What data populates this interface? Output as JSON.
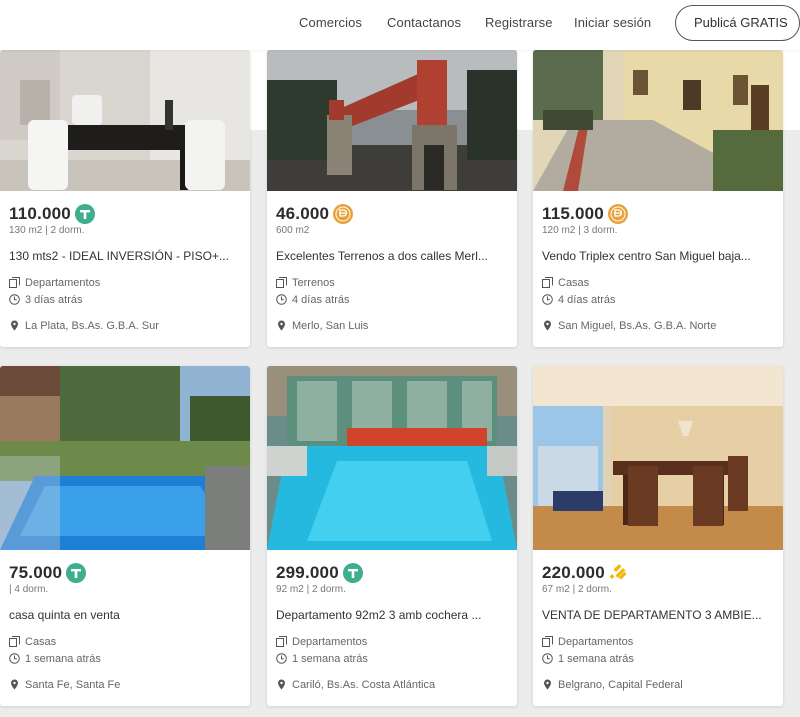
{
  "nav": {
    "links": [
      "Comercios",
      "Contactanos",
      "Registrarse",
      "Iniciar sesión"
    ],
    "cta": "Publicá GRATIS"
  },
  "colors": {
    "dollar_badge": "#3eae8e",
    "peso_badge": "#e9a13a",
    "binance_badge": "#f0b90b"
  },
  "listings": [
    {
      "price": "110.000",
      "currency_icon": "tether-icon",
      "meta": "130 m2 | 2 dorm.",
      "title": "130 mts2 - IDEAL INVERSIÓN - PISO+...",
      "category": "Departamentos",
      "time": "3 días atrás",
      "location": "La Plata, Bs.As. G.B.A. Sur"
    },
    {
      "price": "46.000",
      "currency_icon": "peso-coin-icon",
      "meta": "600 m2",
      "title": "Excelentes Terrenos a dos calles Merl...",
      "category": "Terrenos",
      "time": "4 días atrás",
      "location": "Merlo, San Luis"
    },
    {
      "price": "115.000",
      "currency_icon": "peso-coin-icon",
      "meta": "120 m2 | 3 dorm.",
      "title": "Vendo Triplex centro San Miguel baja...",
      "category": "Casas",
      "time": "4 días atrás",
      "location": "San Miguel, Bs.As. G.B.A. Norte"
    },
    {
      "price": "75.000",
      "currency_icon": "tether-icon",
      "meta": "| 4 dorm.",
      "title": "casa quinta en venta",
      "category": "Casas",
      "time": "1 semana atrás",
      "location": "Santa Fe, Santa Fe"
    },
    {
      "price": "299.000",
      "currency_icon": "tether-icon",
      "meta": "92 m2 | 2 dorm.",
      "title": "Departamento 92m2 3 amb cochera ...",
      "category": "Departamentos",
      "time": "1 semana atrás",
      "location": "Cariló, Bs.As. Costa Atlántica"
    },
    {
      "price": "220.000",
      "currency_icon": "binance-coin-icon",
      "meta": "67 m2 | 2 dorm.",
      "title": "VENTA DE DEPARTAMENTO 3 AMBIE...",
      "category": "Departamentos",
      "time": "1 semana atrás",
      "location": "Belgrano, Capital Federal"
    }
  ]
}
